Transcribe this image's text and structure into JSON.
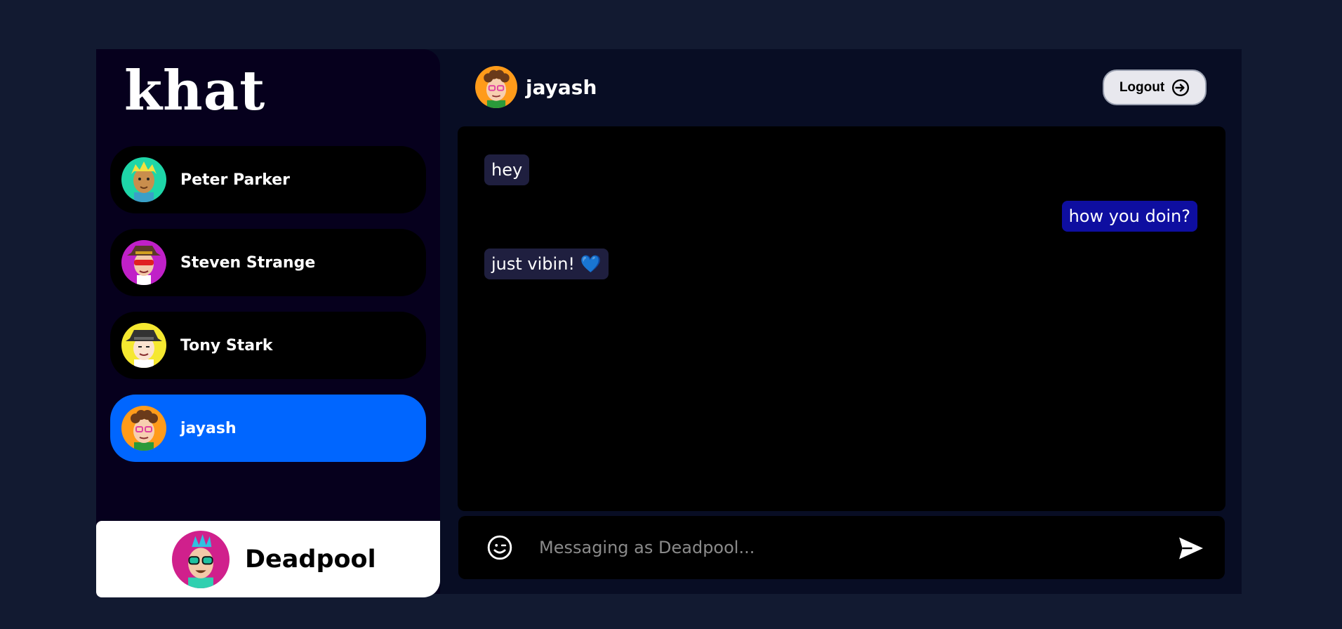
{
  "app": {
    "logo": "khat"
  },
  "sidebar": {
    "contacts": [
      {
        "name": "Peter Parker",
        "avatar": "blonde-boy-avatar",
        "active": false
      },
      {
        "name": "Steven Strange",
        "avatar": "masked-hat-avatar",
        "active": false
      },
      {
        "name": "Tony Stark",
        "avatar": "fedora-man-avatar",
        "active": false
      },
      {
        "name": "jayash",
        "avatar": "curly-glasses-avatar",
        "active": true
      }
    ],
    "current_user": {
      "name": "Deadpool",
      "avatar": "mohawk-sunglasses-avatar"
    }
  },
  "chat": {
    "header": {
      "name": "jayash",
      "avatar": "curly-glasses-avatar"
    },
    "logout_label": "Logout",
    "messages": [
      {
        "text": "hey",
        "direction": "in"
      },
      {
        "text": "how you doin?",
        "direction": "out"
      },
      {
        "text": "just vibin! 💙",
        "direction": "in"
      }
    ],
    "composer": {
      "placeholder": "Messaging as Deadpool...",
      "emoji_icon": "smiley-icon",
      "send_icon": "send-icon"
    }
  },
  "colors": {
    "page_bg": "#121a31",
    "sidebar_bg": "#06001d",
    "active_contact": "#0066ff",
    "outgoing_bubble": "#0e0ea0",
    "incoming_bubble": "#1f1f3f"
  }
}
